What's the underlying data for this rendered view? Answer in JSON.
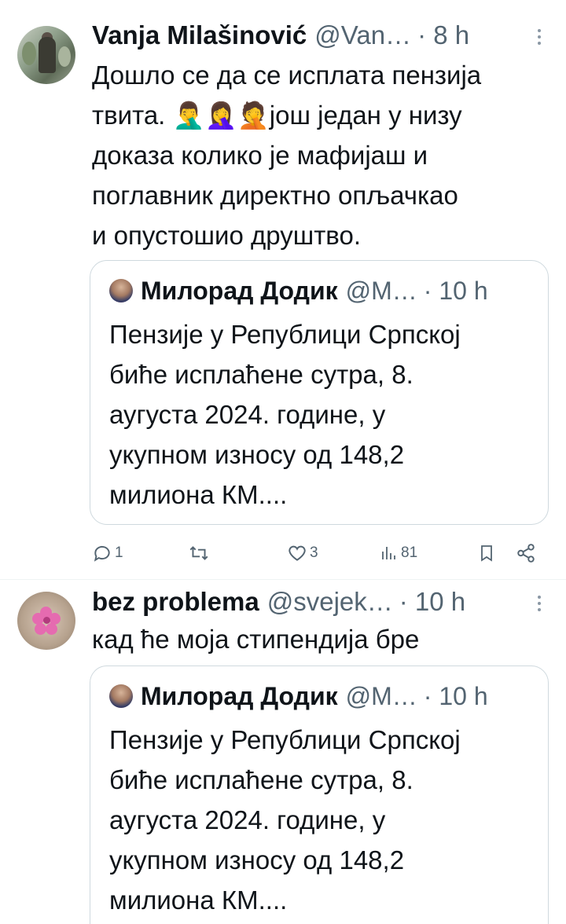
{
  "tweets": [
    {
      "author_name": "Vanja Milašinović",
      "handle": "@Van…",
      "time": "· 8 h",
      "text": "Дошло се да се исплата пензија\nтвита. 🤦‍♂️🤦‍♀️🤦још један у низу\nдоказа колико је мафијаш и\nпоглавник директно опљачкао\nи опустошио друштво.",
      "quote": {
        "author_name": "Милорад Додик",
        "handle": "@M…",
        "time": "· 10 h",
        "text": "Пензије у Републици Српској\nбиће исплаћене сутра, 8.\nаугуста 2024. године, у\nукупном износу од 148,2\nмилиона КМ...."
      },
      "actions": {
        "replies": "1",
        "retweets": "",
        "likes": "3",
        "views": "81"
      }
    },
    {
      "author_name": "bez problema",
      "handle": "@svejek…",
      "time": "· 10 h",
      "text": "кад ће моја стипендија бре",
      "quote": {
        "author_name": "Милорад Додик",
        "handle": "@M…",
        "time": "· 10 h",
        "text": "Пензије у Републици Српској\nбиће исплаћене сутра, 8.\nаугуста 2024. године, у\nукупном износу од 148,2\nмилиона КМ...."
      }
    }
  ],
  "icons": {
    "reply": "reply-icon",
    "retweet": "retweet-icon",
    "like": "heart-icon",
    "views": "views-icon",
    "bookmark": "bookmark-icon",
    "share": "share-icon",
    "more": "more-icon"
  },
  "colors": {
    "text": "#0f1419",
    "secondary": "#536471",
    "border": "#cfd9de"
  }
}
